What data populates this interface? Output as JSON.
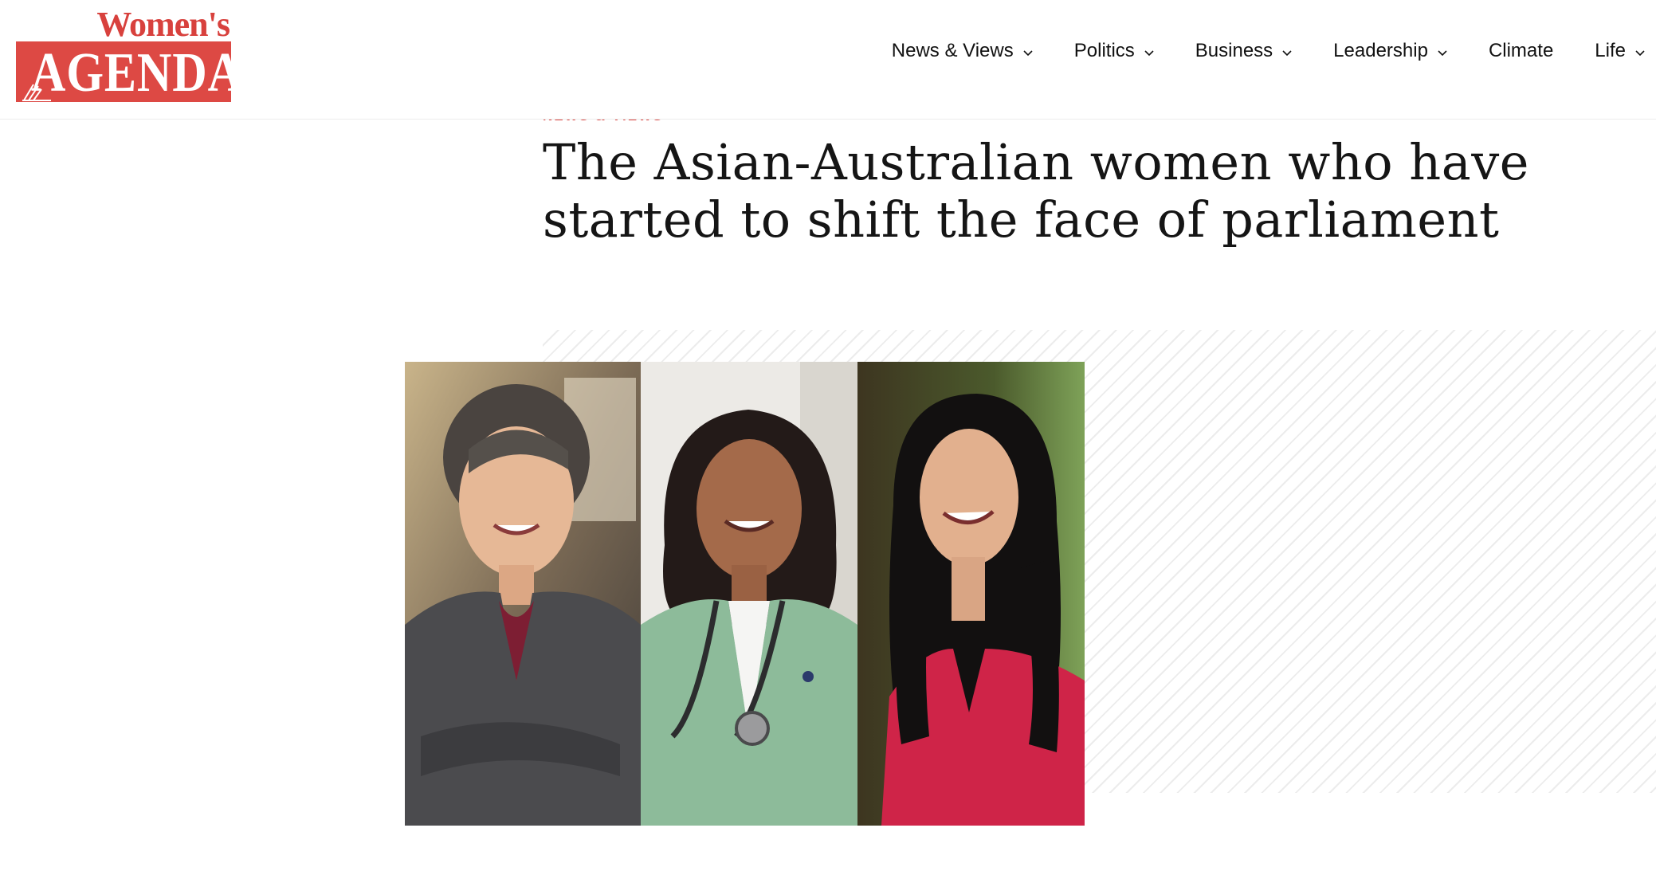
{
  "logo": {
    "top_text": "Women's",
    "main_text": "AGENDA",
    "brand_color": "#dd4944"
  },
  "nav": {
    "items": [
      {
        "label": "News & Views",
        "has_dropdown": true
      },
      {
        "label": "Politics",
        "has_dropdown": true
      },
      {
        "label": "Business",
        "has_dropdown": true
      },
      {
        "label": "Leadership",
        "has_dropdown": true
      },
      {
        "label": "Climate",
        "has_dropdown": false
      },
      {
        "label": "Life",
        "has_dropdown": true
      }
    ],
    "chevron_icon": "chevron-down-icon"
  },
  "article": {
    "category": "NEWS & VIEWS",
    "title": "The Asian-Australian women who have started to shift the face of parliament",
    "accent_color": "#d8413d"
  },
  "hero_image": {
    "panels": 3,
    "icon": "portrait-photo-collage"
  }
}
